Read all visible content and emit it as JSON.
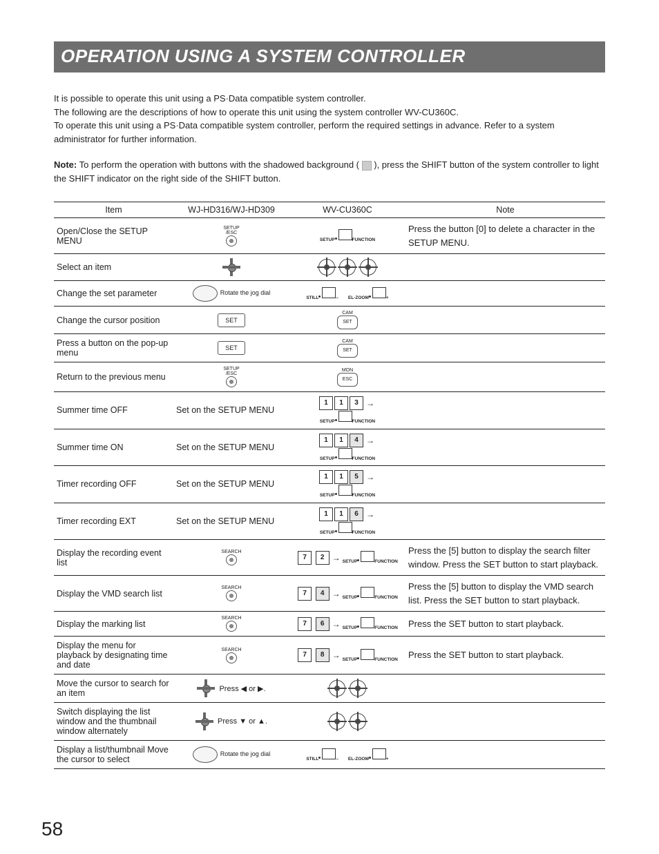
{
  "page_number": "58",
  "title": "OPERATION USING A SYSTEM CONTROLLER",
  "intro": [
    "It is possible to operate this unit using a PS·Data compatible system controller.",
    "The following are the descriptions of how to operate this unit using the system controller WV-CU360C.",
    "To operate this unit using a PS·Data compatible system controller, perform the required settings in advance. Refer to a system administrator for further information."
  ],
  "note_label": "Note:",
  "note_text": "To perform the operation with buttons with the shadowed background ( ",
  "note_text2": " ), press the SHIFT button of the system controller to light the SHIFT indicator on the right side of the SHIFT button.",
  "headers": {
    "item": "Item",
    "col1": "WJ-HD316/WJ-HD309",
    "col2": "WV-CU360C",
    "note": "Note"
  },
  "labels": {
    "setup_esc": "SETUP\n/ESC",
    "function": "FUNCTION",
    "setup": "SETUP",
    "still": "STILL",
    "elzoom": "EL-ZOOM",
    "cam": "CAM",
    "set": "SET",
    "mon": "MON",
    "esc": "ESC",
    "search": "SEARCH",
    "rotate": "Rotate the jog dial",
    "press_lr": "Press ◀ or ▶.",
    "press_ud": "Press ▼ or ▲."
  },
  "rows": [
    {
      "item": "Open/Close the SETUP MENU",
      "note": "Press the button [0] to delete a character in the SETUP MENU."
    },
    {
      "item": "Select an item",
      "note": ""
    },
    {
      "item": "Change the set parameter",
      "note": ""
    },
    {
      "item": "Change the cursor position",
      "note": ""
    },
    {
      "item": "Press a button on the pop-up menu",
      "note": ""
    },
    {
      "item": "Return to the previous menu",
      "note": ""
    },
    {
      "item": "Summer time OFF",
      "c1": "Set on the SETUP MENU",
      "k": [
        "1",
        "1",
        "3"
      ],
      "shade": [
        false,
        false,
        false
      ],
      "note": ""
    },
    {
      "item": "Summer time ON",
      "c1": "Set on the SETUP MENU",
      "k": [
        "1",
        "1",
        "4"
      ],
      "shade": [
        false,
        false,
        true
      ],
      "note": ""
    },
    {
      "item": "Timer recording OFF",
      "c1": "Set on the SETUP MENU",
      "k": [
        "1",
        "1",
        "5"
      ],
      "shade": [
        false,
        false,
        true
      ],
      "note": ""
    },
    {
      "item": "Timer recording EXT",
      "c1": "Set on the SETUP MENU",
      "k": [
        "1",
        "1",
        "6"
      ],
      "shade": [
        false,
        false,
        true
      ],
      "note": ""
    },
    {
      "item": "Display the recording event list",
      "c1": "SEARCH_BTN",
      "k": [
        "7",
        "2"
      ],
      "shade": [
        false,
        false
      ],
      "note": "Press the [5] button to display the search filter window. Press the SET button to start playback."
    },
    {
      "item": "Display the VMD search list",
      "c1": "SEARCH_BTN",
      "k": [
        "7",
        "4"
      ],
      "shade": [
        false,
        true
      ],
      "note": "Press the [5] button to display the VMD search list. Press the SET button to start playback."
    },
    {
      "item": "Display the marking list",
      "c1": "SEARCH_BTN",
      "k": [
        "7",
        "6"
      ],
      "shade": [
        false,
        true
      ],
      "note": "Press the SET button to start playback."
    },
    {
      "item": "Display the menu for playback by designating time and date",
      "c1": "SEARCH_BTN",
      "k": [
        "7",
        "8"
      ],
      "shade": [
        false,
        true
      ],
      "note": "Press the SET button to start playback."
    },
    {
      "item": "Move the cursor to search for an item",
      "note": ""
    },
    {
      "item": "Switch displaying the list window and the thumbnail window alternately",
      "note": ""
    },
    {
      "item": "Display a list/thumbnail Move the cursor to select",
      "note": ""
    }
  ]
}
